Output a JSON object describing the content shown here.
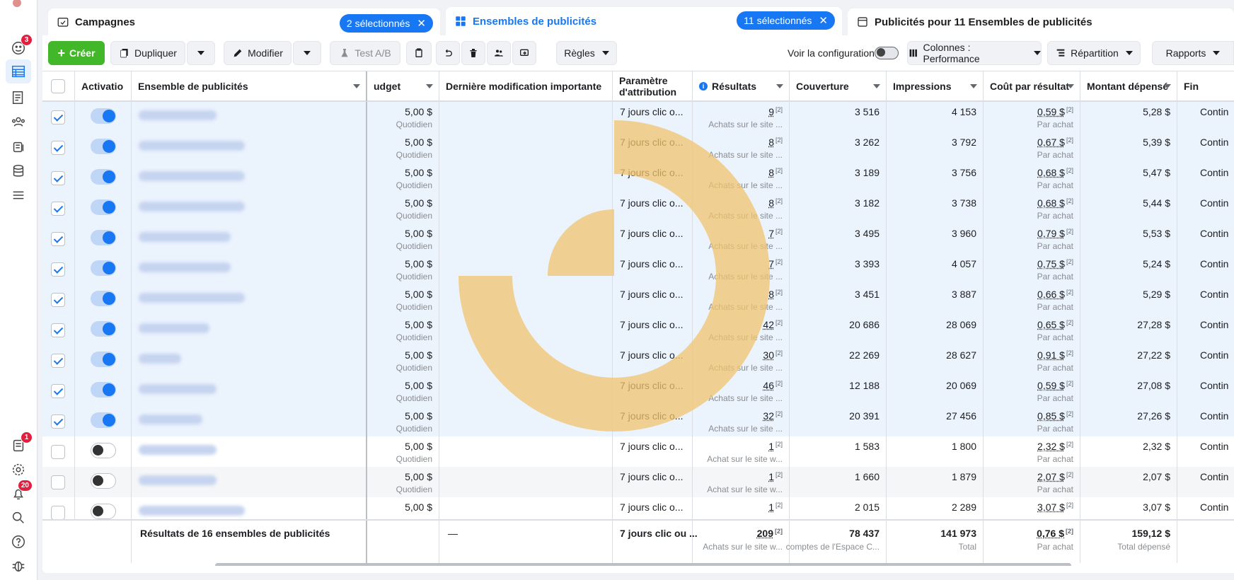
{
  "sidebar": {
    "badges": {
      "home": "3",
      "pages": "1",
      "notifications": "20"
    }
  },
  "tabs": {
    "campaigns": {
      "label": "Campagnes",
      "pill": "2 sélectionnés"
    },
    "adsets": {
      "label": "Ensembles de publicités",
      "pill": "11 sélectionnés"
    },
    "ads": {
      "label": "Publicités pour 11 Ensembles de publicités"
    }
  },
  "toolbar": {
    "create": "Créer",
    "duplicate": "Dupliquer",
    "edit": "Modifier",
    "abtest": "Test A/B",
    "rules": "Règles",
    "view_config": "Voir la configuration",
    "columns": "Colonnes : Performance",
    "breakdown": "Répartition",
    "reports": "Rapports"
  },
  "columns": {
    "activation": "Activatio",
    "adset": "Ensemble de publicités",
    "budget": "udget",
    "last_mod": "Dernière modification importante",
    "attribution": "Paramètre d'attribution",
    "results": "Résultats",
    "reach": "Couverture",
    "impressions": "Impressions",
    "cost": "Coût par résultat",
    "spent": "Montant dépensé",
    "end": "Fin"
  },
  "rows": [
    {
      "budget": "5,00 $",
      "budget_sub": "Quotidien",
      "attr": "7 jours clic o...",
      "res": "9",
      "res_sub": "Achats sur le site ...",
      "reach": "3 516",
      "impr": "4 153",
      "cost": "0,59 $",
      "cost_sub": "Par achat",
      "spent": "5,28 $",
      "end": "Contin"
    },
    {
      "budget": "5,00 $",
      "budget_sub": "Quotidien",
      "attr": "7 jours clic o...",
      "res": "8",
      "res_sub": "Achats sur le site ...",
      "reach": "3 262",
      "impr": "3 792",
      "cost": "0,67 $",
      "cost_sub": "Par achat",
      "spent": "5,39 $",
      "end": "Contin"
    },
    {
      "budget": "5,00 $",
      "budget_sub": "Quotidien",
      "attr": "7 jours clic o...",
      "res": "8",
      "res_sub": "Achats sur le site ...",
      "reach": "3 189",
      "impr": "3 756",
      "cost": "0,68 $",
      "cost_sub": "Par achat",
      "spent": "5,47 $",
      "end": "Contin"
    },
    {
      "budget": "5,00 $",
      "budget_sub": "Quotidien",
      "attr": "7 jours clic o...",
      "res": "8",
      "res_sub": "Achats sur le site ...",
      "reach": "3 182",
      "impr": "3 738",
      "cost": "0,68 $",
      "cost_sub": "Par achat",
      "spent": "5,44 $",
      "end": "Contin"
    },
    {
      "budget": "5,00 $",
      "budget_sub": "Quotidien",
      "attr": "7 jours clic o...",
      "res": "7",
      "res_sub": "Achats sur le site ...",
      "reach": "3 495",
      "impr": "3 960",
      "cost": "0,79 $",
      "cost_sub": "Par achat",
      "spent": "5,53 $",
      "end": "Contin"
    },
    {
      "budget": "5,00 $",
      "budget_sub": "Quotidien",
      "attr": "7 jours clic o...",
      "res": "7",
      "res_sub": "Achats sur le site ...",
      "reach": "3 393",
      "impr": "4 057",
      "cost": "0,75 $",
      "cost_sub": "Par achat",
      "spent": "5,24 $",
      "end": "Contin"
    },
    {
      "budget": "5,00 $",
      "budget_sub": "Quotidien",
      "attr": "7 jours clic o...",
      "res": "8",
      "res_sub": "Achats sur le site ...",
      "reach": "3 451",
      "impr": "3 887",
      "cost": "0,66 $",
      "cost_sub": "Par achat",
      "spent": "5,29 $",
      "end": "Contin"
    },
    {
      "budget": "5,00 $",
      "budget_sub": "Quotidien",
      "attr": "7 jours clic o...",
      "res": "42",
      "res_sub": "Achats sur le site ...",
      "reach": "20 686",
      "impr": "28 069",
      "cost": "0,65 $",
      "cost_sub": "Par achat",
      "spent": "27,28 $",
      "end": "Contin"
    },
    {
      "budget": "5,00 $",
      "budget_sub": "Quotidien",
      "attr": "7 jours clic o...",
      "res": "30",
      "res_sub": "Achats sur le site ...",
      "reach": "22 269",
      "impr": "28 627",
      "cost": "0,91 $",
      "cost_sub": "Par achat",
      "spent": "27,22 $",
      "end": "Contin"
    },
    {
      "budget": "5,00 $",
      "budget_sub": "Quotidien",
      "attr": "7 jours clic o...",
      "res": "46",
      "res_sub": "Achats sur le site ...",
      "reach": "12 188",
      "impr": "20 069",
      "cost": "0,59 $",
      "cost_sub": "Par achat",
      "spent": "27,08 $",
      "end": "Contin"
    },
    {
      "budget": "5,00 $",
      "budget_sub": "Quotidien",
      "attr": "7 jours clic o...",
      "res": "32",
      "res_sub": "Achats sur le site ...",
      "reach": "20 391",
      "impr": "27 456",
      "cost": "0,85 $",
      "cost_sub": "Par achat",
      "spent": "27,26 $",
      "end": "Contin"
    },
    {
      "budget": "5,00 $",
      "budget_sub": "Quotidien",
      "attr": "7 jours clic o...",
      "res": "1",
      "res_sub": "Achat sur le site w...",
      "reach": "1 583",
      "impr": "1 800",
      "cost": "2,32 $",
      "cost_sub": "Par achat",
      "spent": "2,32 $",
      "end": "Contin"
    },
    {
      "budget": "5,00 $",
      "budget_sub": "Quotidien",
      "attr": "7 jours clic o...",
      "res": "1",
      "res_sub": "Achat sur le site w...",
      "reach": "1 660",
      "impr": "1 879",
      "cost": "2,07 $",
      "cost_sub": "Par achat",
      "spent": "2,07 $",
      "end": "Contin"
    },
    {
      "budget": "5,00 $",
      "budget_sub": "",
      "attr": "7 jours clic o...",
      "res": "1",
      "res_sub": "",
      "reach": "2 015",
      "impr": "2 289",
      "cost": "3,07 $",
      "cost_sub": "",
      "spent": "3,07 $",
      "end": "Contin"
    }
  ],
  "footer": {
    "label": "Résultats de 16 ensembles de publicités",
    "last_mod": "—",
    "attr": "7 jours clic ou ...",
    "res": "209",
    "res_sub": "Achats sur le site w...",
    "reach": "78 437",
    "reach_sub": "comptes de l'Espace C...",
    "impr": "141 973",
    "impr_sub": "Total",
    "cost": "0,76 $",
    "cost_sub": "Par achat",
    "spent": "159,12 $",
    "spent_sub": "Total dépensé"
  },
  "colors": {
    "accent": "#1877f2",
    "create": "#42b72a",
    "badge": "#e41e3f",
    "selected_row": "#ebf3fd",
    "decor": "#f2c46d"
  }
}
